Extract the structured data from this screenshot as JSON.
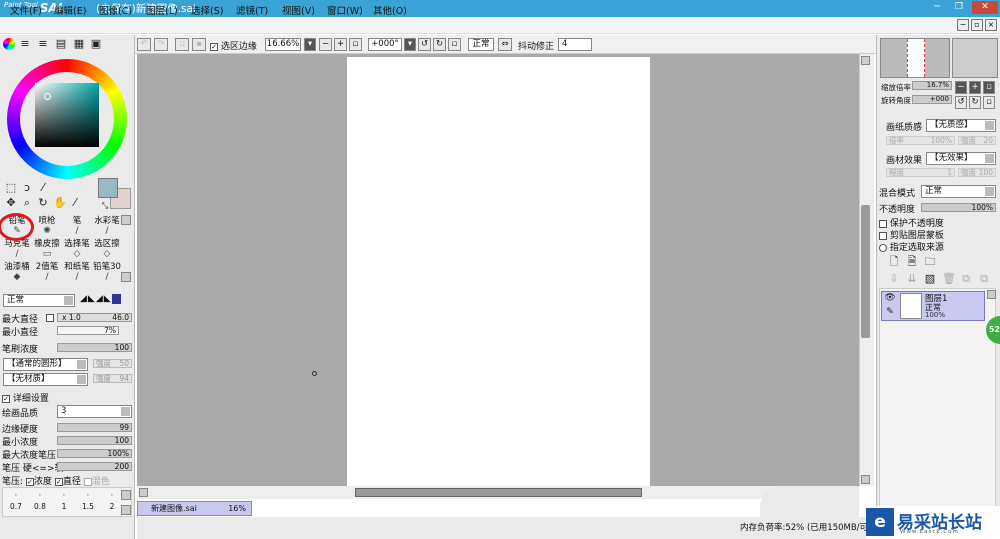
{
  "titlebar": {
    "app_sub": "Paint Tool",
    "app_name": "SAI",
    "doc_title": "(未保存)新建图像.sai",
    "min": "─",
    "max": "❐",
    "close": "✕"
  },
  "menus": [
    "文件(F)",
    "编辑(E)",
    "图像(C)",
    "图层(L)",
    "选择(S)",
    "滤镜(T)",
    "视图(V)",
    "窗口(W)",
    "其他(O)"
  ],
  "toolbar": {
    "selection_edge": "选区边缘",
    "zoom": "16.66%",
    "angle": "+000°",
    "mode": "正常",
    "stabilizer_label": "抖动修正",
    "stabilizer": "4"
  },
  "colors": {
    "primary": "#9ab8c4",
    "secondary": "#e3d3cf"
  },
  "tools": [
    {
      "label": "铅笔",
      "icon": "✎"
    },
    {
      "label": "喷枪",
      "icon": "✺"
    },
    {
      "label": "笔",
      "icon": "/"
    },
    {
      "label": "水彩笔",
      "icon": "/"
    },
    {
      "label": "马克笔",
      "icon": "/"
    },
    {
      "label": "橡皮擦",
      "icon": "▭"
    },
    {
      "label": "选择笔",
      "icon": "◇"
    },
    {
      "label": "选区擦",
      "icon": "◇"
    },
    {
      "label": "油漆桶",
      "icon": "◆"
    },
    {
      "label": "2值笔",
      "icon": "/"
    },
    {
      "label": "和纸笔",
      "icon": "/"
    },
    {
      "label": "铅笔30",
      "icon": "/"
    }
  ],
  "brush": {
    "mode": "正常",
    "max_diam_label": "最大直径",
    "max_diam_mult": "x 1.0",
    "max_diam": "46.0",
    "min_diam_label": "最小直径",
    "min_diam": "7%",
    "density_label": "笔刷浓度",
    "density": "100",
    "shape": "【通常的圆形】",
    "shape_strength_label": "强度",
    "shape_strength": "50",
    "texture": "【无材质】",
    "texture_strength_label": "强度",
    "texture_strength": "94",
    "detail_label": "详细设置",
    "quality_label": "绘画品质",
    "quality": "3",
    "edge_label": "边缘硬度",
    "edge": "99",
    "min_density_label": "最小浓度",
    "min_density": "100",
    "max_pressure_label": "最大浓度笔压",
    "max_pressure": "100%",
    "pressure_label": "笔压 硬<=>软",
    "pressure": "200",
    "pressure_opts_label": "笔压:",
    "opt_density": "浓度",
    "opt_diam": "直径",
    "opt_mix": "混色",
    "sizes": [
      "0.7",
      "0.8",
      "1",
      "1.5",
      "2"
    ]
  },
  "right": {
    "zoom_label": "缩放倍率",
    "zoom": "16.7%",
    "rot_label": "旋转角度",
    "rot": "+000",
    "paper_label": "画纸质感",
    "paper": "【无质感】",
    "paper_mult_label": "倍率",
    "paper_mult": "100%",
    "paper_str_label": "强度",
    "paper_str": "20",
    "effect_label": "画材效果",
    "effect": "【无效果】",
    "effect_deg_label": "程度",
    "effect_deg": "1",
    "effect_str_label": "强度",
    "effect_str": "100",
    "blend_label": "混合模式",
    "blend": "正常",
    "opacity_label": "不透明度",
    "opacity": "100%",
    "protect": "保护不透明度",
    "clip": "剪贴图层蒙板",
    "source": "指定选取来源",
    "layer_name": "图层1",
    "layer_mode": "正常",
    "layer_opacity": "100%"
  },
  "canvas": {
    "tab": "新建图像.sai",
    "tab_zoom": "16%"
  },
  "status": {
    "mem": "内存负荷率:52%",
    "used": "(已用150MB/可用"
  },
  "watermark": {
    "text": "易采站长站",
    "sub": "Www.Easck.Com"
  },
  "badge": "52"
}
